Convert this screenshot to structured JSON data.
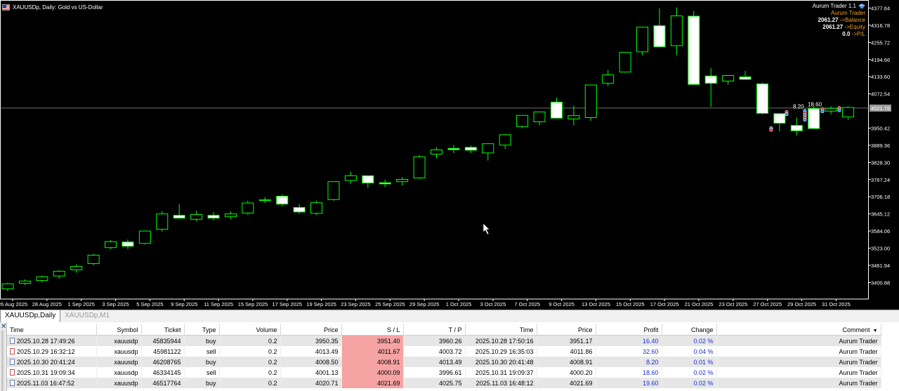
{
  "chart": {
    "title": "XAUUSDp, Daily:  Gold vs US-Dollar",
    "current_price": "4021.78",
    "price_ticks": [
      "4377.84",
      "4316.78",
      "4255.72",
      "4194.66",
      "4133.60",
      "4072.54",
      "3950.42",
      "3889.36",
      "3828.30",
      "3767.24",
      "3706.18",
      "3645.12",
      "3584.06",
      "3523.00",
      "3461.94",
      "3400.88"
    ],
    "date_ticks": [
      "26 Aug 2025",
      "28 Aug 2025",
      "1 Sep 2025",
      "3 Sep 2025",
      "5 Sep 2025",
      "9 Sep 2025",
      "11 Sep 2025",
      "15 Sep 2025",
      "17 Sep 2025",
      "19 Sep 2025",
      "23 Sep 2025",
      "25 Sep 2025",
      "29 Sep 2025",
      "1 Oct 2025",
      "3 Oct 2025",
      "7 Oct 2025",
      "9 Oct 2025",
      "13 Oct 2025",
      "15 Oct 2025",
      "17 Oct 2025",
      "21 Oct 2025",
      "23 Oct 2025",
      "27 Oct 2025",
      "29 Oct 2025",
      "31 Oct 2025"
    ],
    "trade_labels": [
      "8.20",
      "18.60"
    ],
    "colors": {
      "bull": "#00ff00",
      "bear_fill": "#ffffff",
      "background": "#000000",
      "axis_text": "#ffffff"
    }
  },
  "ea": {
    "name": "Aurum Trader 1.1",
    "subtitle": "Aurum Trader",
    "balance_value": "2061.27",
    "balance_label": "->Balance",
    "equity_value": "2061.27",
    "equity_label": "->Equity",
    "pl_value": "0.0",
    "pl_label": "->P/L"
  },
  "tabs": [
    "XAUUSDp,Daily",
    "XAUUSDp,M1"
  ],
  "table": {
    "headers": [
      "Time",
      "Symbol",
      "Ticket",
      "Type",
      "Volume",
      "Price",
      "S / L",
      "T / P",
      "Time",
      "Price",
      "Profit",
      "Change",
      "Comment"
    ],
    "rows": [
      [
        "2025.10.28 17:49:26",
        "xauusdp",
        "45835944",
        "buy",
        "0.2",
        "3950.35",
        "3951.40",
        "3960.26",
        "2025.10.28 17:50:16",
        "3951.17",
        "16.40",
        "0.02 %",
        "Aurum Trader"
      ],
      [
        "2025.10.29 16:32:12",
        "xauusdp",
        "45981122",
        "sell",
        "0.2",
        "4013.49",
        "4011.67",
        "4003.72",
        "2025.10.29 16:35:03",
        "4011.86",
        "32.60",
        "0.04 %",
        "Aurum Trader"
      ],
      [
        "2025.10.30 20:41:24",
        "xauusdp",
        "46208765",
        "buy",
        "0.2",
        "4008.50",
        "4008.91",
        "4013.49",
        "2025.10.30 20:41:48",
        "4008.91",
        "8.20",
        "0.01 %",
        "Aurum Trader"
      ],
      [
        "2025.10.31 19:09:34",
        "xauusdp",
        "46334145",
        "sell",
        "0.2",
        "4001.13",
        "4000.09",
        "3996.61",
        "2025.10.31 19:09:37",
        "4000.20",
        "18.60",
        "0.02 %",
        "Aurum Trader"
      ],
      [
        "2025.11.03 16:47:52",
        "xauusdp",
        "46517764",
        "buy",
        "0.2",
        "4020.71",
        "4021.69",
        "4025.75",
        "2025.11.03 16:48:12",
        "4021.69",
        "19.60",
        "0.02 %",
        "Aurum Trader"
      ]
    ]
  }
}
